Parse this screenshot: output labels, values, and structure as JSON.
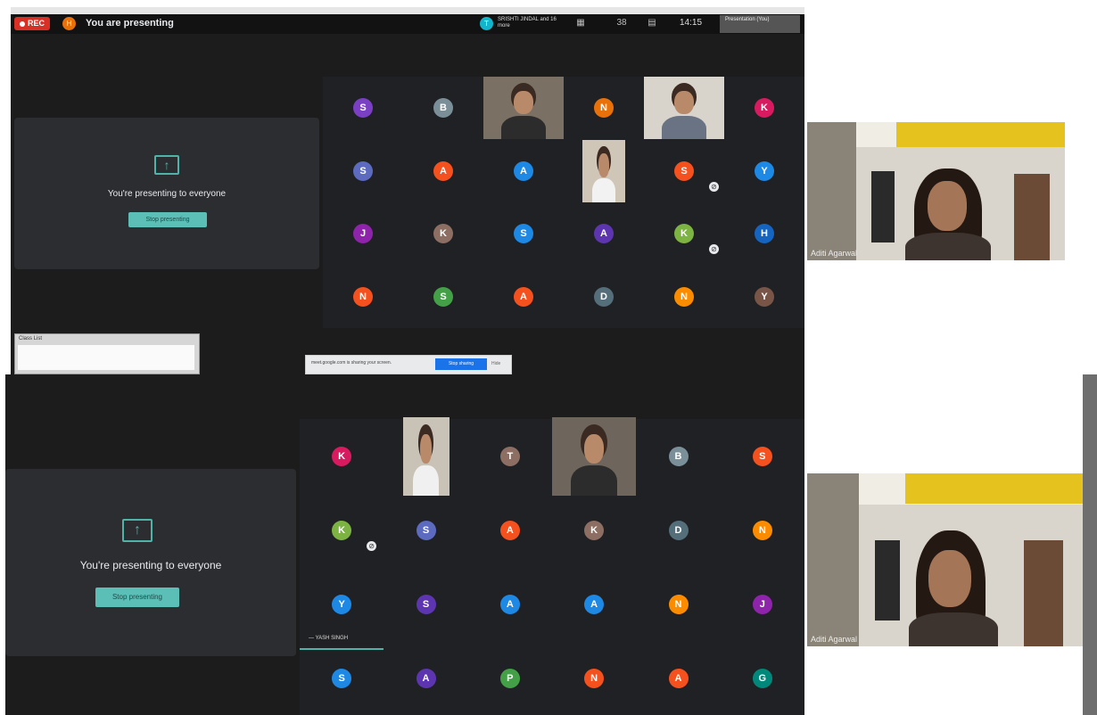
{
  "top": {
    "rec_label": "REC",
    "presenter_initial": "H",
    "presenting_text": "You are presenting",
    "people_initial": "T",
    "people_text": "SRISHTI JINDAL and 16 more",
    "count_label": "38",
    "clock": "14:15",
    "presentation_label": "Presentation (You)"
  },
  "panel1": {
    "presenting_message": "You're presenting to everyone",
    "stop_button": "Stop presenting",
    "mini_window_title": "Class List",
    "share_text": "meet.google.com is sharing your screen.",
    "share_stop": "Stop sharing",
    "share_hide": "Hide",
    "remote_name": "Aditi Agarwal",
    "tiles": [
      {
        "initial": "S",
        "color": "#7b3fc4"
      },
      {
        "initial": "B",
        "color": "#7b8f99"
      },
      {
        "video": true
      },
      {
        "initial": "N",
        "color": "#e8710a"
      },
      {
        "video": true
      },
      {
        "initial": "K",
        "color": "#d81b60"
      },
      {
        "initial": "S",
        "color": "#5c6bc0"
      },
      {
        "initial": "A",
        "color": "#f4511e"
      },
      {
        "initial": "A",
        "color": "#1e88e5"
      },
      {
        "video": true
      },
      {
        "initial": "S",
        "color": "#f4511e"
      },
      {
        "initial": "Y",
        "color": "#1e88e5"
      },
      {
        "initial": "J",
        "color": "#8e24aa"
      },
      {
        "initial": "K",
        "color": "#8d6e63"
      },
      {
        "initial": "S",
        "color": "#1e88e5"
      },
      {
        "initial": "A",
        "color": "#5e35b1"
      },
      {
        "initial": "K",
        "color": "#7cb342"
      },
      {
        "initial": "H",
        "color": "#1565c0"
      },
      {
        "initial": "N",
        "color": "#f4511e"
      },
      {
        "initial": "S",
        "color": "#43a047"
      },
      {
        "initial": "A",
        "color": "#f4511e"
      },
      {
        "initial": "D",
        "color": "#546e7a"
      },
      {
        "initial": "N",
        "color": "#fb8c00"
      },
      {
        "initial": "Y",
        "color": "#795548"
      }
    ]
  },
  "panel2": {
    "presenting_message": "You're presenting to everyone",
    "stop_button": "Stop presenting",
    "speaker_label": "YASH SINGH",
    "remote_name": "Aditi Agarwal",
    "tiles": [
      {
        "initial": "K",
        "color": "#d81b60"
      },
      {
        "video": true
      },
      {
        "initial": "T",
        "color": "#8d6e63"
      },
      {
        "video": true
      },
      {
        "initial": "B",
        "color": "#7b8f99"
      },
      {
        "initial": "S",
        "color": "#f4511e"
      },
      {
        "initial": "K",
        "color": "#7cb342"
      },
      {
        "initial": "S",
        "color": "#5c6bc0"
      },
      {
        "initial": "A",
        "color": "#f4511e"
      },
      {
        "initial": "K",
        "color": "#8d6e63"
      },
      {
        "initial": "D",
        "color": "#546e7a"
      },
      {
        "initial": "N",
        "color": "#fb8c00"
      },
      {
        "initial": "Y",
        "color": "#1e88e5"
      },
      {
        "initial": "S",
        "color": "#5e35b1"
      },
      {
        "initial": "A",
        "color": "#1e88e5"
      },
      {
        "initial": "A",
        "color": "#1e88e5"
      },
      {
        "initial": "N",
        "color": "#fb8c00"
      },
      {
        "initial": "J",
        "color": "#8e24aa"
      },
      {
        "initial": "S",
        "color": "#1e88e5"
      },
      {
        "initial": "A",
        "color": "#5e35b1"
      },
      {
        "initial": "P",
        "color": "#43a047"
      },
      {
        "initial": "N",
        "color": "#f4511e"
      },
      {
        "initial": "A",
        "color": "#f4511e"
      },
      {
        "initial": "G",
        "color": "#00897b"
      }
    ]
  }
}
